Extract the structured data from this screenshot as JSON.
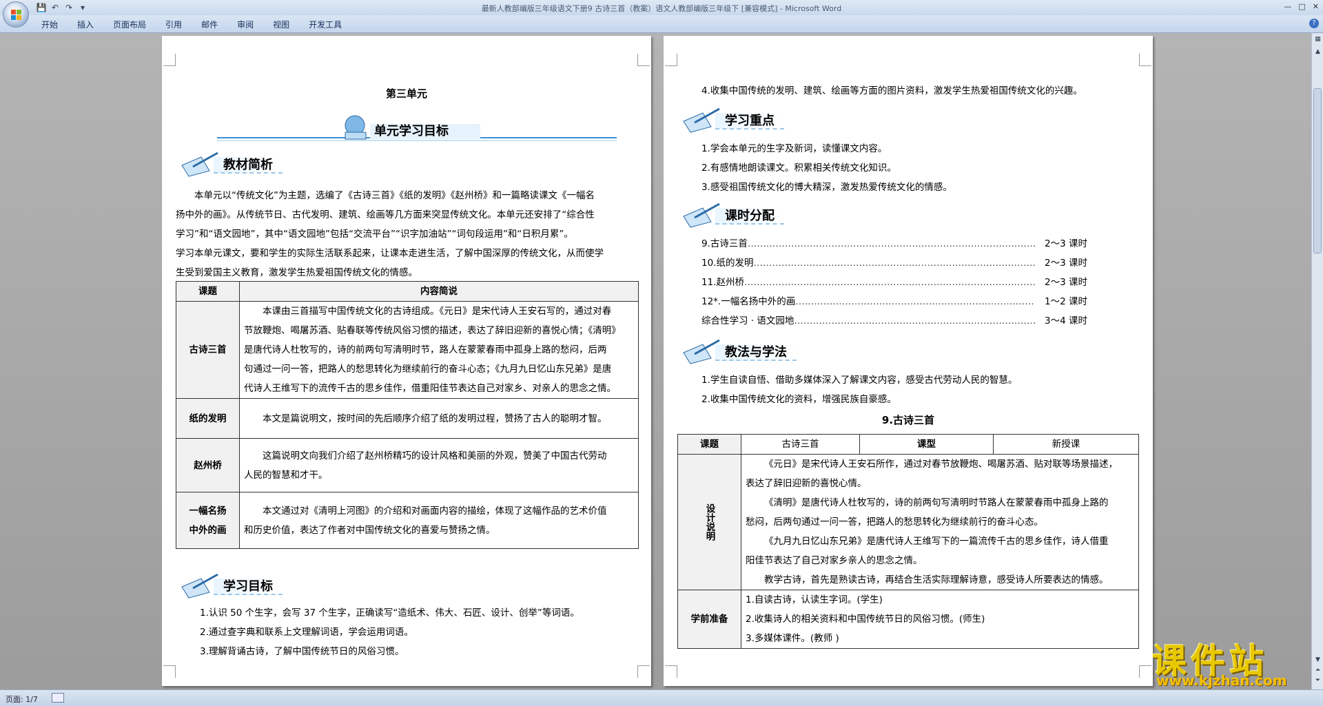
{
  "window": {
    "title": "最新人教部编版三年级语文下册9 古诗三首（教案）语文人教部编版三年级下 [兼容模式] - Microsoft Word"
  },
  "ribbon": {
    "tabs": [
      "开始",
      "插入",
      "页面布局",
      "引用",
      "邮件",
      "审阅",
      "视图",
      "开发工具"
    ]
  },
  "status": {
    "page": "页面: 1/7"
  },
  "page1": {
    "unit_title": "第三单元",
    "goal_banner": "单元学习目标",
    "section1": "教材简析",
    "intro": [
      "本单元以“传统文化”为主题，选编了《古诗三首》《纸的发明》《赵州桥》和一篇略读课文《一幅名",
      "扬中外的画》。从传统节日、古代发明、建筑、绘画等几方面来突显传统文化。本单元还安排了“综合性",
      "学习”和“语文园地”，其中“语文园地”包括“交流平台”“识字加油站”“词句段运用”和“日积月累”。",
      "学习本单元课文，要和学生的实际生活联系起来，让课本走进生活，了解中国深厚的传统文化，从而使学",
      "生受到爱国主义教育，激发学生热爱祖国传统文化的情感。"
    ],
    "table": {
      "h1": "课题",
      "h2": "内容简说",
      "rows": [
        {
          "t": "古诗三首",
          "c": [
            "本课由三首描写中国传统文化的古诗组成。《元日》是宋代诗人王安石写的，通过对春",
            "节放鞭炮、喝屠苏酒、贴春联等传统风俗习惯的描述，表达了辞旧迎新的喜悦心情；《清明》",
            "是唐代诗人杜牧写的，诗的前两句写清明时节，路人在蒙蒙春雨中孤身上路的愁闷，后两",
            "句通过一问一答，把路人的愁思转化为继续前行的奋斗心态；《九月九日忆山东兄弟》是唐",
            "代诗人王维写下的流传千古的思乡佳作，借重阳佳节表达自己对家乡、对亲人的思念之情。"
          ]
        },
        {
          "t": "纸的发明",
          "c": [
            "本文是篇说明文，按时间的先后顺序介绍了纸的发明过程，赞扬了古人的聪明才智。"
          ]
        },
        {
          "t": "赵州桥",
          "c": [
            "这篇说明文向我们介绍了赵州桥精巧的设计风格和美丽的外观，赞美了中国古代劳动",
            "人民的智慧和才干。"
          ]
        },
        {
          "t1": "一幅名扬",
          "t2": "中外的画",
          "c": [
            "本文通过对《清明上河图》的介绍和对画面内容的描绘，体现了这幅作品的艺术价值",
            "和历史价值，表达了作者对中国传统文化的喜爱与赞扬之情。"
          ]
        }
      ]
    },
    "section2": "学习目标",
    "goals": [
      "1.认识 50 个生字，会写 37 个生字，正确读写“造纸术、伟大、石匠、设计、创举”等词语。",
      "2.通过查字典和联系上文理解词语，学会运用词语。",
      "3.理解背诵古诗，了解中国传统节日的风俗习惯。"
    ]
  },
  "page2": {
    "goal4": "4.收集中国传统的发明、建筑、绘画等方面的图片资料，激发学生热爱祖国传统文化的兴趣。",
    "section_key": "学习重点",
    "keys": [
      "1.学会本单元的生字及新词，读懂课文内容。",
      "2.有感情地朗读课文。积累相关传统文化知识。",
      "3.感受祖国传统文化的博大精深，激发热爱传统文化的情感。"
    ],
    "section_time": "课时分配",
    "schedule": [
      {
        "name": "9.古诗三首",
        "hours": "2～3 课时"
      },
      {
        "name": "10.纸的发明",
        "hours": "2～3 课时"
      },
      {
        "name": "11.赵州桥",
        "hours": "2～3 课时"
      },
      {
        "name": "12*.一幅名扬中外的画",
        "hours": "1～2 课时"
      },
      {
        "name": "综合性学习 · 语文园地",
        "hours": "3～4 课时"
      }
    ],
    "section_method": "教法与学法",
    "methods": [
      "1.学生自读自悟、借助多媒体深入了解课文内容，感受古代劳动人民的智慧。",
      "2.收集中国传统文化的资料，增强民族自豪感。"
    ],
    "lesson_title": "9.古诗三首",
    "lesson_table": {
      "l1": "课题",
      "v1": "古诗三首",
      "l2": "课型",
      "v2": "新授课",
      "design_label": "设计说明",
      "design": [
        "《元日》是宋代诗人王安石所作，通过对春节放鞭炮、喝屠苏酒、贴对联等场景描述，",
        "表达了辞旧迎新的喜悦心情。",
        "《清明》是唐代诗人杜牧写的，诗的前两句写清明时节路人在蒙蒙春雨中孤身上路的",
        "愁闷，后两句通过一问一答，把路人的愁思转化为继续前行的奋斗心态。",
        "《九月九日忆山东兄弟》是唐代诗人王维写下的一篇流传千古的思乡佳作，诗人借重",
        "阳佳节表达了自己对家乡亲人的思念之情。",
        "教学古诗，首先是熟读古诗，再结合生活实际理解诗意，感受诗人所要表达的情感。"
      ],
      "prep_label": "学前准备",
      "prep": [
        "1.自读古诗，认读生字词。(学生)",
        "2.收集诗人的相关资料和中国传统节日的风俗习惯。(师生)",
        "3.多媒体课件。(教师 )"
      ]
    }
  },
  "watermark": {
    "cn": "课件站",
    "url": "www.kjzhan.com"
  }
}
